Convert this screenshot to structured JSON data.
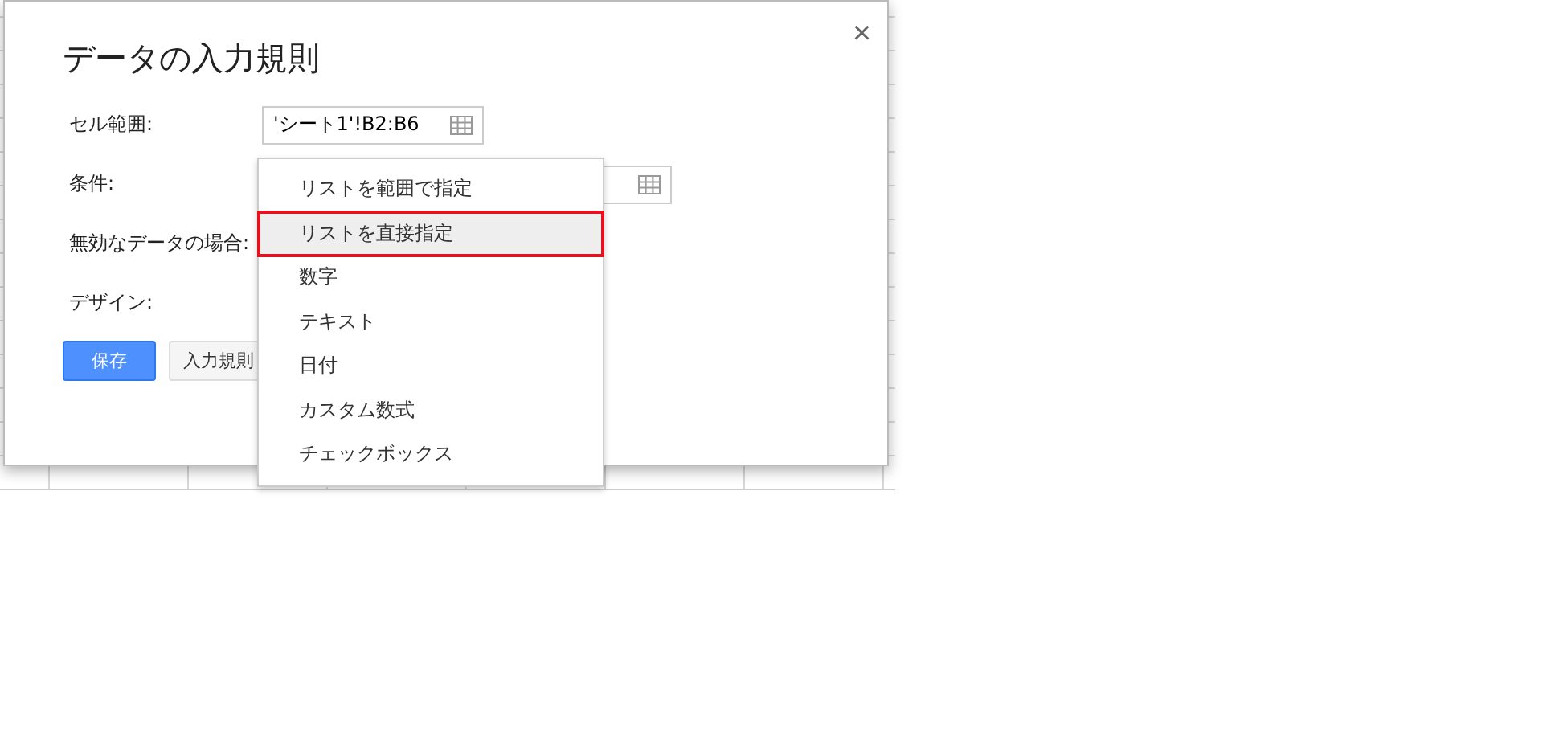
{
  "dialog": {
    "title": "データの入力規則",
    "close": "×",
    "fields": [
      {
        "label": "セル範囲:",
        "value": "'シート1'!B2:B6",
        "kind": "range"
      },
      {
        "label": "条件:",
        "kind": "criteria"
      },
      {
        "label": "無効なデータの場合:",
        "kind": "plain"
      },
      {
        "label": "デザイン:",
        "kind": "plain"
      }
    ],
    "buttons": [
      {
        "label": "保存",
        "kind": "primary"
      },
      {
        "label": "入力規則",
        "kind": "secondary"
      }
    ]
  },
  "menu": {
    "items": [
      {
        "label": "リストを範囲で指定",
        "selected": false
      },
      {
        "label": "リストを直接指定",
        "selected": true
      },
      {
        "label": "数字",
        "selected": false
      },
      {
        "label": "テキスト",
        "selected": false
      },
      {
        "label": "日付",
        "selected": false
      },
      {
        "label": "カスタム数式",
        "selected": false
      },
      {
        "label": "チェックボックス",
        "selected": false
      }
    ]
  }
}
